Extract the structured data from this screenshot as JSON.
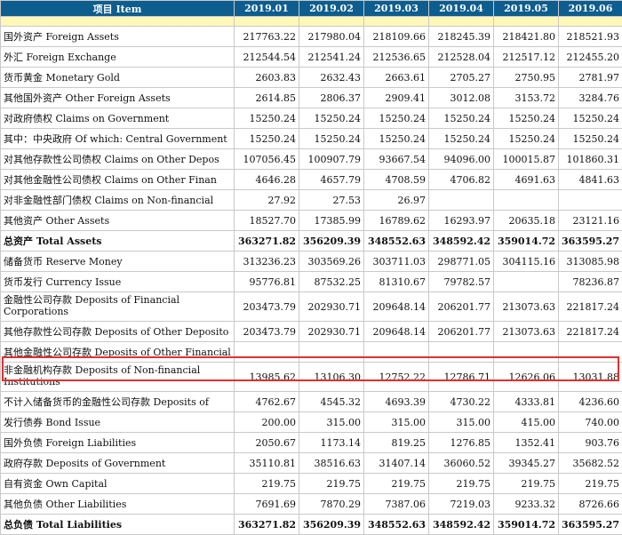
{
  "table": {
    "header": [
      "项目 Item",
      "2019.01",
      "2019.02",
      "2019.03",
      "2019.04",
      "2019.05",
      "2019.06"
    ],
    "rows": [
      {
        "label": "国外资产  Foreign Assets",
        "values": [
          "217763.22",
          "217980.04",
          "218109.66",
          "218245.39",
          "218421.80",
          "218521.93"
        ]
      },
      {
        "label": "外汇  Foreign Exchange",
        "values": [
          "212544.54",
          "212541.24",
          "212536.65",
          "212528.04",
          "212517.12",
          "212455.20"
        ]
      },
      {
        "label": "货币黄金  Monetary Gold",
        "values": [
          "2603.83",
          "2632.43",
          "2663.61",
          "2705.27",
          "2750.95",
          "2781.97"
        ]
      },
      {
        "label": "其他国外资产  Other Foreign Assets",
        "values": [
          "2614.85",
          "2806.37",
          "2909.41",
          "3012.08",
          "3153.72",
          "3284.76"
        ]
      },
      {
        "label": "对政府债权  Claims on Government",
        "values": [
          "15250.24",
          "15250.24",
          "15250.24",
          "15250.24",
          "15250.24",
          "15250.24"
        ]
      },
      {
        "label": "其中：中央政府  Of which: Central Government",
        "values": [
          "15250.24",
          "15250.24",
          "15250.24",
          "15250.24",
          "15250.24",
          "15250.24"
        ]
      },
      {
        "label": "对其他存款性公司债权  Claims on Other Depos",
        "values": [
          "107056.45",
          "100907.79",
          "93667.54",
          "94096.00",
          "100015.87",
          "101860.31"
        ]
      },
      {
        "label": "对其他金融性公司债权  Claims on Other Finan",
        "values": [
          "4646.28",
          "4657.79",
          "4708.59",
          "4706.82",
          "4691.63",
          "4841.63"
        ]
      },
      {
        "label": "对非金融性部门债权  Claims on Non-financial",
        "values": [
          "27.92",
          "27.53",
          "26.97",
          "",
          "",
          ""
        ]
      },
      {
        "label": "其他资产  Other Assets",
        "values": [
          "18527.70",
          "17385.99",
          "16789.62",
          "16293.97",
          "20635.18",
          "23121.16"
        ]
      },
      {
        "label": "总资产  Total Assets",
        "values": [
          "363271.82",
          "356209.39",
          "348552.63",
          "348592.42",
          "359014.72",
          "363595.27"
        ]
      },
      {
        "label": "储备货币  Reserve Money",
        "values": [
          "313236.23",
          "303569.26",
          "303711.03",
          "298771.05",
          "304115.16",
          "313085.98"
        ]
      },
      {
        "label": "货币发行  Currency Issue",
        "values": [
          "95776.81",
          "87532.25",
          "81310.67",
          "79782.57",
          "",
          "78236.87"
        ]
      },
      {
        "label": "金融性公司存款  Deposits of Financial Corporations",
        "values": [
          "203473.79",
          "202930.71",
          "209648.14",
          "206201.77",
          "213073.63",
          "221817.24"
        ]
      },
      {
        "label": "其他存款性公司存款  Deposits of Other Deposito",
        "values": [
          "203473.79",
          "202930.71",
          "209648.14",
          "206201.77",
          "213073.63",
          "221817.24"
        ]
      },
      {
        "label": "其他金融性公司存款  Deposits of Other Financial",
        "values": [
          "",
          "",
          "",
          "",
          "",
          ""
        ]
      },
      {
        "label": "非金融机构存款  Deposits of Non-financial Institutions",
        "values": [
          "13985.62",
          "13106.30",
          "12752.22",
          "12786.71",
          "12626.06",
          "13031.88"
        ]
      },
      {
        "label": "不计入储备货币的金融性公司存款  Deposits of",
        "values": [
          "4762.67",
          "4545.32",
          "4693.39",
          "4730.22",
          "4333.81",
          "4236.60"
        ]
      },
      {
        "label": "发行债券  Bond Issue",
        "values": [
          "200.00",
          "315.00",
          "315.00",
          "315.00",
          "415.00",
          "740.00"
        ]
      },
      {
        "label": "国外负债  Foreign Liabilities",
        "values": [
          "2050.67",
          "1173.14",
          "819.25",
          "1276.85",
          "1352.41",
          "903.76"
        ]
      },
      {
        "label": "政府存款  Deposits of Government",
        "values": [
          "35110.81",
          "38516.63",
          "31407.14",
          "36060.52",
          "39345.27",
          "35682.52"
        ]
      },
      {
        "label": "自有资金  Own Capital",
        "values": [
          "219.75",
          "219.75",
          "219.75",
          "219.75",
          "219.75",
          "219.75"
        ]
      },
      {
        "label": "其他负债  Other Liabilities",
        "values": [
          "7691.69",
          "7870.29",
          "7387.06",
          "7219.03",
          "9233.32",
          "8726.66"
        ]
      },
      {
        "label": "总负债  Total  Liabilities",
        "values": [
          "363271.82",
          "356209.39",
          "348552.63",
          "348592.42",
          "359014.72",
          "363595.27"
        ]
      }
    ]
  }
}
